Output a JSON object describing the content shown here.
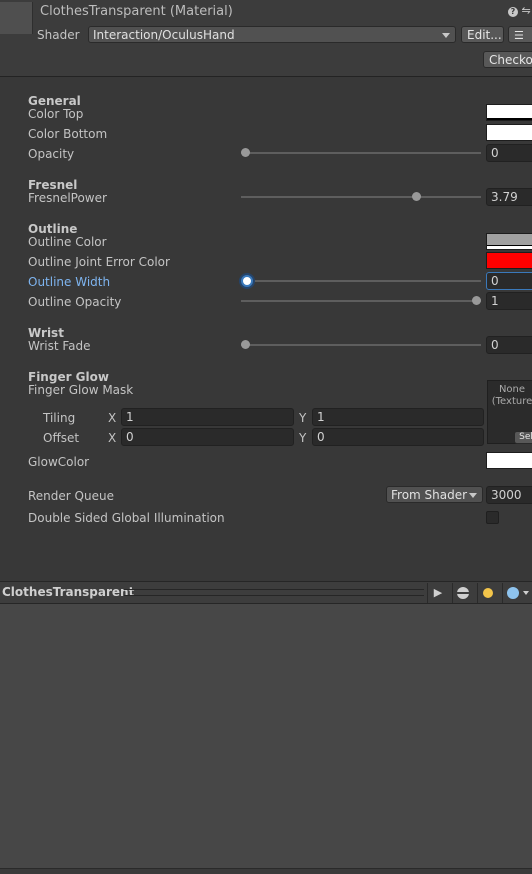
{
  "header": {
    "title": "ClothesTransparent (Material)",
    "shader_label": "Shader",
    "shader_value": "Interaction/OculusHand",
    "edit_button": "Edit...",
    "checkout_button": "Checko",
    "help_icon_glyph": "?"
  },
  "sections": {
    "general": {
      "heading": "General",
      "color_top_label": "Color Top",
      "color_bottom_label": "Color Bottom",
      "opacity_label": "Opacity",
      "opacity_value": "0"
    },
    "fresnel": {
      "heading": "Fresnel",
      "power_label": "FresnelPower",
      "power_value": "3.79"
    },
    "outline": {
      "heading": "Outline",
      "color_label": "Outline Color",
      "joint_error_label": "Outline Joint Error Color",
      "width_label": "Outline Width",
      "width_value": "0",
      "opacity_label": "Outline Opacity",
      "opacity_value": "1"
    },
    "wrist": {
      "heading": "Wrist",
      "fade_label": "Wrist Fade",
      "fade_value": "0"
    },
    "finger_glow": {
      "heading": "Finger Glow",
      "mask_label": "Finger Glow Mask",
      "texture_none": "None",
      "texture_type": "(Texture",
      "select_button": "Sel",
      "tiling_label": "Tiling",
      "offset_label": "Offset",
      "x_label": "X",
      "y_label": "Y",
      "tiling_x": "1",
      "tiling_y": "1",
      "offset_x": "0",
      "offset_y": "0",
      "glow_color_label": "GlowColor"
    }
  },
  "render_queue": {
    "label": "Render Queue",
    "mode": "From Shader",
    "value": "3000"
  },
  "double_sided": {
    "label": "Double Sided Global Illumination"
  },
  "preview": {
    "title": "ClothesTransparent",
    "play_glyph": "▶"
  },
  "slider_levels": {
    "opacity": 0.0,
    "fresnel_power": 0.74,
    "outline_width": 0.0,
    "outline_opacity": 1.0,
    "wrist_fade": 0.0
  },
  "colors": {
    "color_top": "#ffffff",
    "color_bottom": "#ffffff",
    "outline_color": "#a0a0a0",
    "outline_joint_error_color": "#ff0000",
    "glow_color": "#ffffff",
    "accent": "#3a79bb",
    "active_label": "#7eb4ef"
  }
}
